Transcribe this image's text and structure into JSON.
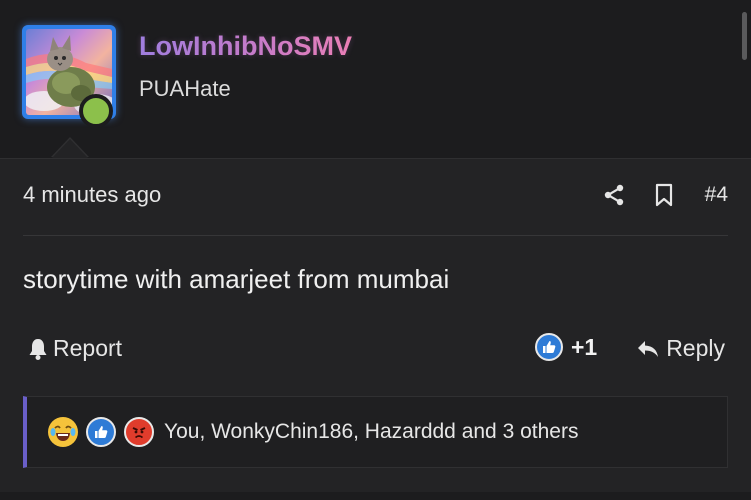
{
  "post": {
    "username": "LowInhibNoSMV",
    "user_title": "PUAHate",
    "timestamp": "4 minutes ago",
    "post_number": "#4",
    "body": "storytime with amarjeet from mumbai",
    "actions": {
      "report_label": "Report",
      "score": "+1",
      "reply_label": "Reply"
    },
    "reactions": {
      "icons": [
        "laughing-crying-emoji",
        "like-thumbs-up",
        "angry-face"
      ],
      "summary": "You, WonkyChin186, Hazarddd and 3 others"
    }
  },
  "colors": {
    "background": "#232325",
    "header_background": "#1c1c1e",
    "avatar_border": "#2f7fe8",
    "online_status": "#8cc04b",
    "username_gradient": [
      "#9c7ee0",
      "#f07fb2"
    ],
    "reaction_accent": "#6a5fc9",
    "like_blue": "#2e7bd6"
  }
}
